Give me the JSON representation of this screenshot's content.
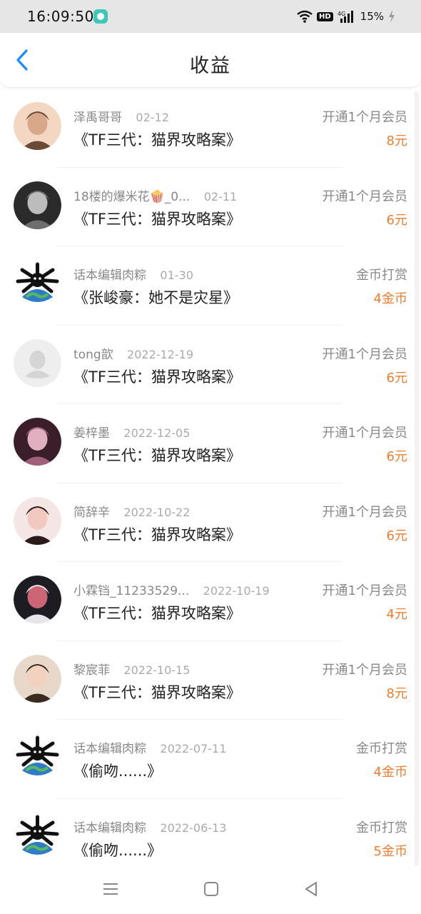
{
  "status_bar": {
    "time": "16:09:50",
    "hd": "HD",
    "network": "4G",
    "battery": "15%"
  },
  "header": {
    "title": "收益"
  },
  "rows": [
    {
      "name": "泽禹哥哥",
      "date": "02-12",
      "work": "《TF三代：猫界攻略案》",
      "type": "开通1个月会员",
      "amount": "8元",
      "avatar": "photo"
    },
    {
      "name": "18楼的爆米花🍿_0...",
      "date": "02-11",
      "work": "《TF三代：猫界攻略案》",
      "type": "开通1个月会员",
      "amount": "6元",
      "avatar": "photo"
    },
    {
      "name": "话本编辑肉粽",
      "date": "01-30",
      "work": "《张峻豪：她不是灾星》",
      "type": "金币打赏",
      "amount": "4金币",
      "avatar": "mascot"
    },
    {
      "name": "tong歆",
      "date": "2022-12-19",
      "work": "《TF三代：猫界攻略案》",
      "type": "开通1个月会员",
      "amount": "6元",
      "avatar": "default"
    },
    {
      "name": "姜梓墨",
      "date": "2022-12-05",
      "work": "《TF三代：猫界攻略案》",
      "type": "开通1个月会员",
      "amount": "6元",
      "avatar": "photo"
    },
    {
      "name": "简辞辛",
      "date": "2022-10-22",
      "work": "《TF三代：猫界攻略案》",
      "type": "开通1个月会员",
      "amount": "6元",
      "avatar": "photo"
    },
    {
      "name": "小霖铛_11233529...",
      "date": "2022-10-19",
      "work": "《TF三代：猫界攻略案》",
      "type": "开通1个月会员",
      "amount": "4元",
      "avatar": "photo"
    },
    {
      "name": "黎宸菲",
      "date": "2022-10-15",
      "work": "《TF三代：猫界攻略案》",
      "type": "开通1个月会员",
      "amount": "8元",
      "avatar": "photo"
    },
    {
      "name": "话本编辑肉粽",
      "date": "2022-07-11",
      "work": "《偷吻......》",
      "type": "金币打赏",
      "amount": "4金币",
      "avatar": "mascot"
    },
    {
      "name": "话本编辑肉粽",
      "date": "2022-06-13",
      "work": "《偷吻......》",
      "type": "金币打赏",
      "amount": "5金币",
      "avatar": "mascot"
    }
  ],
  "colors": {
    "accent_back": "#1a8cff",
    "amount": "#f07c2d"
  },
  "icons": {
    "back": "chevron-left-icon",
    "nav_menu": "menu-icon",
    "nav_home": "square-home-icon",
    "nav_back": "triangle-back-icon"
  }
}
